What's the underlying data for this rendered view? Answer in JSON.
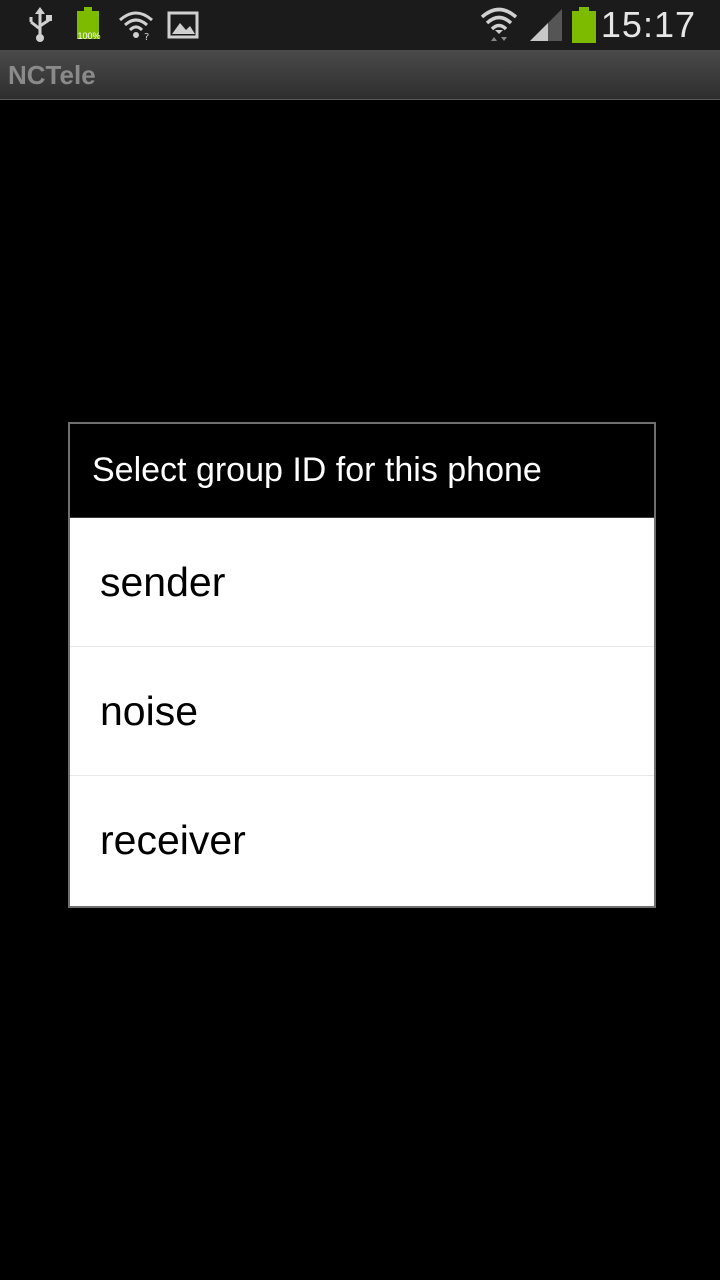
{
  "status_bar": {
    "time": "15:17",
    "battery_small_label": "100%",
    "icons": [
      "usb-icon",
      "battery-full-icon",
      "wifi-alert-icon",
      "image-icon",
      "wifi-icon",
      "signal-icon",
      "battery-icon"
    ],
    "accent_color": "#7dbb00"
  },
  "title_bar": {
    "app_title": "NCTele"
  },
  "dialog": {
    "title": "Select group ID for this phone",
    "options": [
      {
        "label": "sender"
      },
      {
        "label": "noise"
      },
      {
        "label": "receiver"
      }
    ]
  }
}
